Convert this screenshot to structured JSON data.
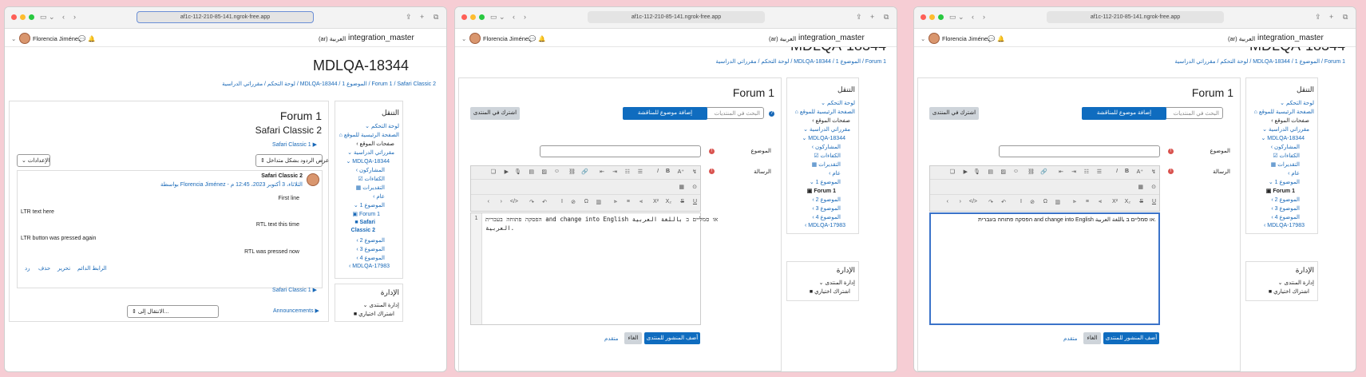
{
  "browser": {
    "url": "af1c-112-210-85-141.ngrok-free.app"
  },
  "header": {
    "user": "Florencia Jiménez",
    "lang": "(ar) العربية",
    "site": "integration_master"
  },
  "course": {
    "title": "MDLQA-18344",
    "title_cut": "MDLQA-18344"
  },
  "breadcrumb1": "لوحة التحكم / مقرراتي الدراسية / MDLQA-18344 / الموضوع 1 / Forum 1 / Safari Classic 2",
  "breadcrumb2": "لوحة التحكم / مقرراتي الدراسية / MDLQA-18344 / الموضوع 1 / Forum 1",
  "nav": {
    "heading": "التنقل",
    "dashboard": "لوحة التحكم",
    "home": "الصفحة الرئيسية للموقع",
    "site_pages": "صفحات الموقع",
    "my_courses": "مقرراتي الدراسية",
    "course": "MDLQA-18344",
    "participants": "المشاركون",
    "competencies": "الكفاءات",
    "grades": "التقديرات",
    "general": "عام",
    "topic1": "الموضوع 1",
    "forum1": "Forum 1",
    "safari1": "Safari",
    "safari2": "Classic 2",
    "topic2": "الموضوع 2",
    "topic3": "الموضوع 3",
    "topic4": "الموضوع 4",
    "course2": "MDLQA-17983"
  },
  "admin": {
    "heading": "الإدارة",
    "forum_admin": "إدارة المنتدى",
    "optional_sub": "اشتراك اختياري"
  },
  "discussion": {
    "forum_title": "Forum 1",
    "disc_title": "Safari Classic 2",
    "nav_prev": "Safari Classic 1 ▶",
    "settings": "الإعدادات",
    "display_mode": "عرض الردود بشكل متداخل",
    "post_subject": "Safari Classic 2",
    "post_meta": "بواسطة Florencia Jiménez - الثلاثاء، 3 أكتوبر 2023، 12:45 م",
    "lines": [
      "First line",
      "LTR text here",
      "RTL text this time",
      "LTR button was pressed again",
      "RTL was pressed now"
    ],
    "actions": {
      "permalink": "الرابط الدائم",
      "edit": "تحرير",
      "delete": "حذف",
      "reply": "رد"
    },
    "nav_next": "Safari Classic 1 ▶",
    "jump": "الانتقال إلى...",
    "announcements": "Announcements ▶"
  },
  "forum": {
    "title": "Forum 1",
    "search_placeholder": "البحث في المنتديات",
    "add_topic": "إضافة موضوع للمناقشة",
    "subscribe": "اشترك في المنتدى",
    "subject_label": "الموضوع",
    "message_label": "الرسالة",
    "code_line1": "‏הפסקה פתוחה בעברית ‎and change into English‎ או סמליים ב باللغة العربية",
    "code_line2": "‏العربية.",
    "rich_text": "‏הפסקה פתוחה בעברית ‎and change into English‎ או סמליים ב باللغة العربية.",
    "submit": "أضف المنشور للمنتدى",
    "cancel": "الغاء",
    "advanced": "متقدم"
  }
}
